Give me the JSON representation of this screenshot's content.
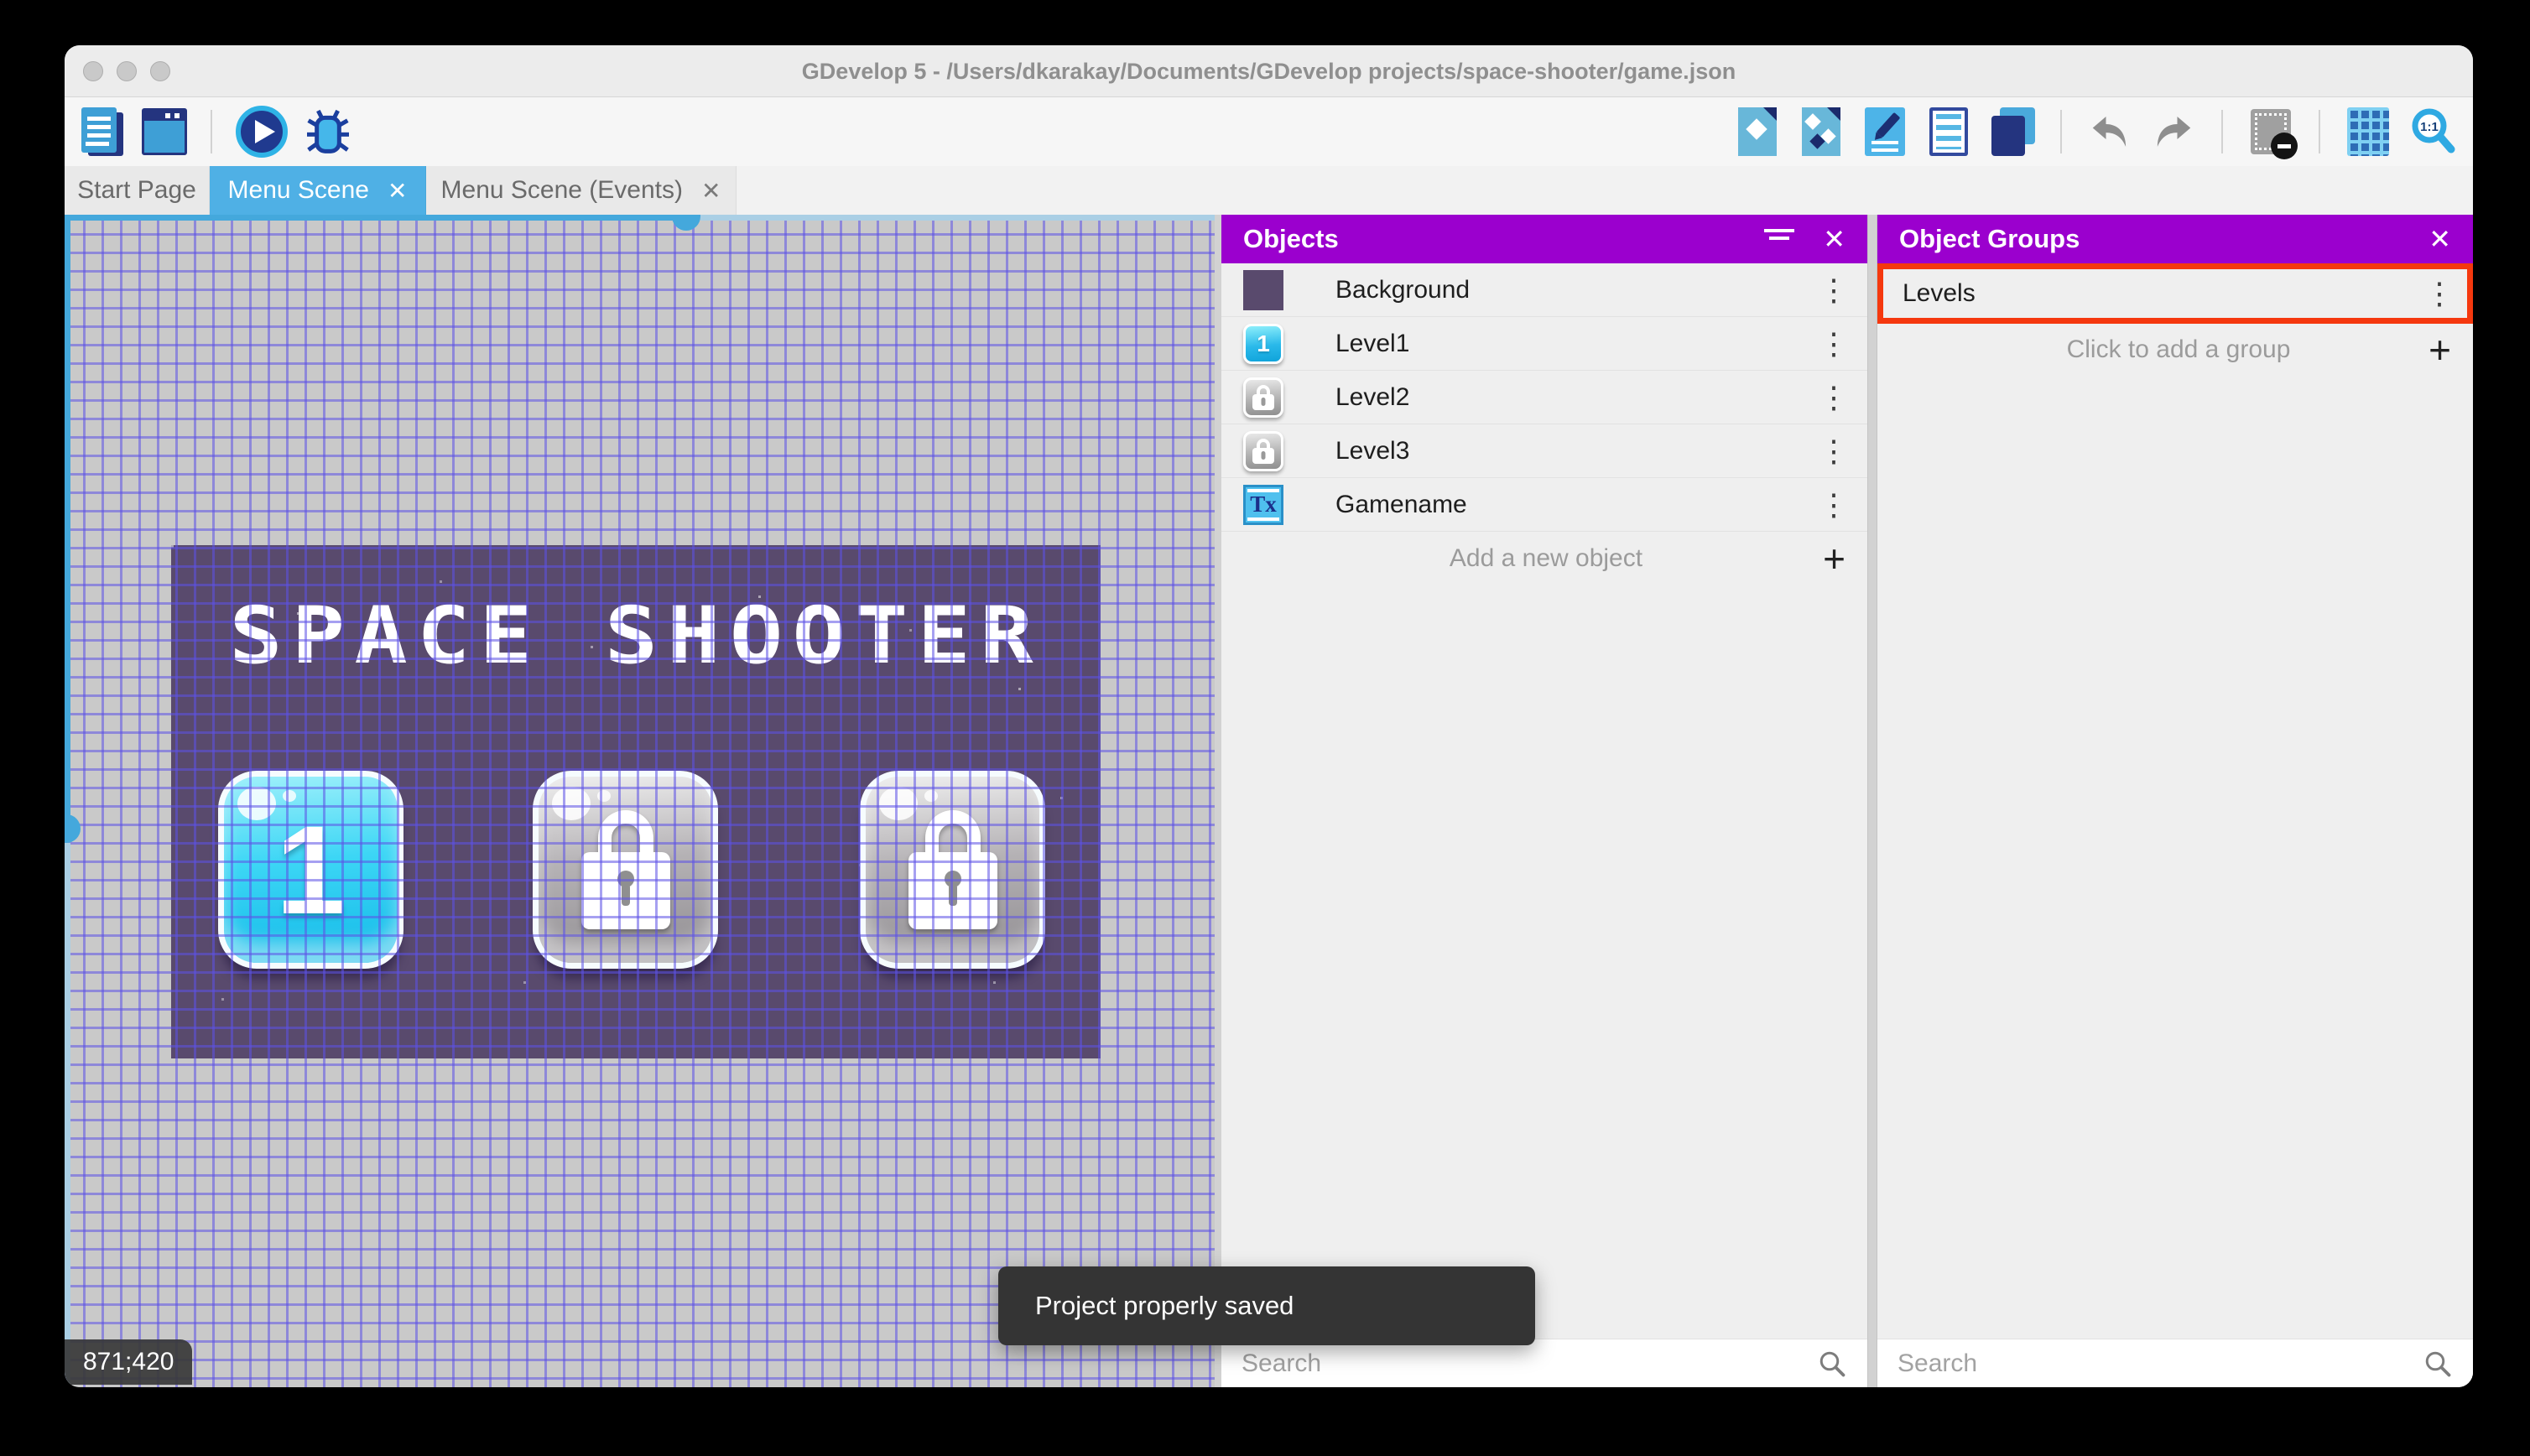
{
  "window": {
    "title": "GDevelop 5 - /Users/dkarakay/Documents/GDevelop projects/space-shooter/game.json"
  },
  "tabs": {
    "start_page": "Start Page",
    "menu_scene": "Menu Scene",
    "menu_scene_events": "Menu Scene (Events)"
  },
  "icons": {
    "close_glyph": "✕",
    "plus_glyph": "+",
    "kebab_glyph": "⋮",
    "text_object_glyph": "Tx",
    "zoom_ratio_label": "1:1"
  },
  "objects_panel": {
    "title": "Objects",
    "rows": [
      {
        "name": "Background",
        "thumb": "purple-square"
      },
      {
        "name": "Level1",
        "thumb": "blue-level-button",
        "thumb_label": "1"
      },
      {
        "name": "Level2",
        "thumb": "locked-level-button"
      },
      {
        "name": "Level3",
        "thumb": "locked-level-button"
      },
      {
        "name": "Gamename",
        "thumb": "text-object"
      }
    ],
    "add_label": "Add a new object",
    "search_placeholder": "Search"
  },
  "object_groups_panel": {
    "title": "Object Groups",
    "groups": [
      {
        "name": "Levels"
      }
    ],
    "add_label": "Click to add a group",
    "search_placeholder": "Search"
  },
  "canvas": {
    "coordinates": "871;420",
    "toast": "Project properly saved"
  },
  "game_preview": {
    "title": "SPACE SHOOTER",
    "buttons": [
      {
        "state": "unlocked",
        "label": "1"
      },
      {
        "state": "locked",
        "label": ""
      },
      {
        "state": "locked",
        "label": ""
      }
    ]
  },
  "colors": {
    "accent_blue": "#4fb0e5",
    "panel_header_purple": "#9b00ce",
    "annotation_red": "#f5380e",
    "game_background_purple": "#594a6d",
    "toast_background": "#343434",
    "canvas_gray": "#c9c9c9",
    "grid_line_blue": "#5d52e6"
  }
}
